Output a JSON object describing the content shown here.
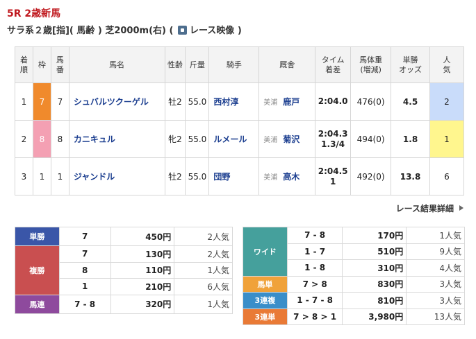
{
  "race": {
    "title": "5R 2歳新馬",
    "info_prefix": "サラ系２歳[指]( 馬齢 ) 芝2000m(右)  (",
    "video_label": "レース映像 )"
  },
  "results": {
    "headers": {
      "rank": [
        "着",
        "順"
      ],
      "waku": "枠",
      "num": [
        "馬",
        "番"
      ],
      "horse": "馬名",
      "sexage": "性齢",
      "weight": "斤量",
      "jockey": "騎手",
      "trainer": "厩舎",
      "time": [
        "タイム",
        "着差"
      ],
      "body": [
        "馬体重",
        "(増減)"
      ],
      "odds": [
        "単勝",
        "オッズ"
      ],
      "pop": [
        "人",
        "気"
      ]
    },
    "rows": [
      {
        "rank": "1",
        "waku": "7",
        "num": "7",
        "horse": "シュバルツクーゲル",
        "sexage": "牡2",
        "weight": "55.0",
        "jockey": "西村淳",
        "aff": "美浦",
        "trainer": "鹿戸",
        "time": "2:04.0",
        "margin": "",
        "body": "476(0)",
        "odds": "4.5",
        "pop": "2"
      },
      {
        "rank": "2",
        "waku": "8",
        "num": "8",
        "horse": "カニキュル",
        "sexage": "牝2",
        "weight": "55.0",
        "jockey": "ルメール",
        "aff": "美浦",
        "trainer": "菊沢",
        "time": "2:04.3",
        "margin": "1.3/4",
        "body": "494(0)",
        "odds": "1.8",
        "pop": "1"
      },
      {
        "rank": "3",
        "waku": "1",
        "num": "1",
        "horse": "ジャンドル",
        "sexage": "牡2",
        "weight": "55.0",
        "jockey": "団野",
        "aff": "美浦",
        "trainer": "高木",
        "time": "2:04.5",
        "margin": "1",
        "body": "492(0)",
        "odds": "13.8",
        "pop": "6"
      }
    ]
  },
  "detail_link": "レース結果詳細",
  "payout_left": {
    "tansho": {
      "label": "単勝",
      "rows": [
        {
          "combo": "7",
          "yen": "450円",
          "rank": "2人気"
        }
      ]
    },
    "fukusho": {
      "label": "複勝",
      "rows": [
        {
          "combo": "7",
          "yen": "130円",
          "rank": "2人気"
        },
        {
          "combo": "8",
          "yen": "110円",
          "rank": "1人気"
        },
        {
          "combo": "1",
          "yen": "210円",
          "rank": "6人気"
        }
      ]
    },
    "umaren": {
      "label": "馬連",
      "rows": [
        {
          "combo": "7 - 8",
          "yen": "320円",
          "rank": "1人気"
        }
      ]
    }
  },
  "payout_right": {
    "wide": {
      "label": "ワイド",
      "rows": [
        {
          "combo": "7 - 8",
          "yen": "170円",
          "rank": "1人気"
        },
        {
          "combo": "1 - 7",
          "yen": "510円",
          "rank": "9人気"
        },
        {
          "combo": "1 - 8",
          "yen": "310円",
          "rank": "4人気"
        }
      ]
    },
    "umatan": {
      "label": "馬単",
      "rows": [
        {
          "combo": "7 > 8",
          "yen": "830円",
          "rank": "3人気"
        }
      ]
    },
    "sanrenpuku": {
      "label": "3連複",
      "rows": [
        {
          "combo": "1 - 7 - 8",
          "yen": "810円",
          "rank": "3人気"
        }
      ]
    },
    "sanrentan": {
      "label": "3連単",
      "rows": [
        {
          "combo": "7 > 8 > 1",
          "yen": "3,980円",
          "rank": "13人気"
        }
      ]
    }
  }
}
